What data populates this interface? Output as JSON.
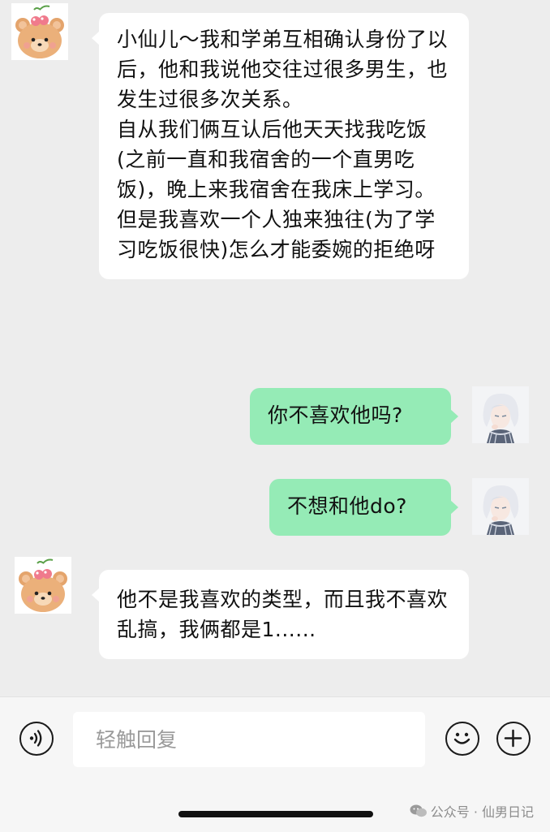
{
  "messages": [
    {
      "side": "left",
      "avatar": "bear-with-cherry-avatar",
      "text": "小仙儿～我和学弟互相确认身份了以后，他和我说他交往过很多男生，也发生过很多次关系。\n自从我们俩互认后他天天找我吃饭(之前一直和我宿舍的一个直男吃饭)，晚上来我宿舍在我床上学习。\n但是我喜欢一个人独来独往(为了学习吃饭很快)怎么才能委婉的拒绝呀"
    },
    {
      "side": "right",
      "avatar": "anime-boy-avatar",
      "text": "你不喜欢他吗?"
    },
    {
      "side": "right",
      "avatar": "anime-boy-avatar",
      "text": "不想和他do?"
    },
    {
      "side": "left",
      "avatar": "bear-with-cherry-avatar",
      "text": "他不是我喜欢的类型，而且我不喜欢乱搞，我俩都是1......"
    }
  ],
  "input_bar": {
    "placeholder": "轻触回复",
    "value": "",
    "voice_icon": "voice-icon",
    "emoji_icon": "emoji-icon",
    "plus_icon": "plus-icon"
  },
  "watermark": {
    "text": "公众号 · 仙男日记",
    "icon": "wechat-icon"
  },
  "colors": {
    "background": "#ededed",
    "bubble_left": "#ffffff",
    "bubble_right": "#95ebb6",
    "input_bar": "#f6f6f6"
  }
}
